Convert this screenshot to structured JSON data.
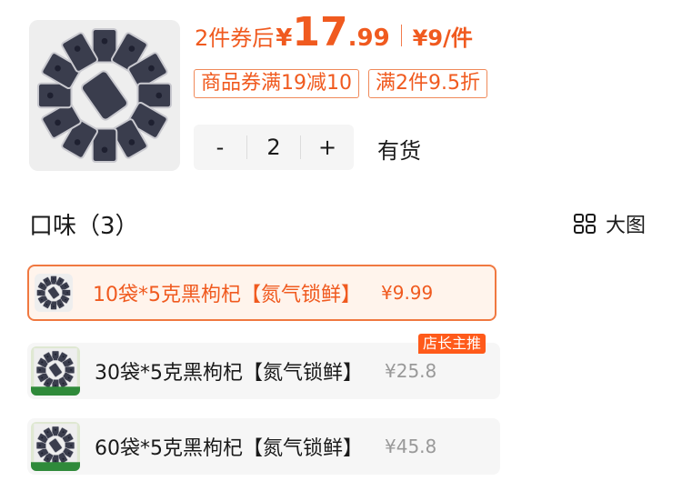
{
  "product": {
    "image_icon": "black-goji-packets-image",
    "price_prefix": "2件券后",
    "currency": "¥",
    "price_int": "17",
    "price_dec": ".99",
    "unit_price": "¥9/件",
    "coupons": [
      "商品券满19减10",
      "满2件9.5折"
    ],
    "quantity": "2",
    "minus_label": "-",
    "plus_label": "+",
    "stock": "有货"
  },
  "flavor": {
    "title": "口味（3）",
    "bigview_label": "大图",
    "bigview_icon": "grid-icon",
    "options": [
      {
        "name": "10袋*5克黑枸杞【氮气锁鲜】",
        "price": "¥9.99",
        "selected": true
      },
      {
        "name": "30袋*5克黑枸杞【氮气锁鲜】",
        "price": "¥25.8",
        "badge": "店长主推"
      },
      {
        "name": "60袋*5克黑枸杞【氮气锁鲜】",
        "price": "¥45.8"
      }
    ]
  },
  "colors": {
    "accent": "#f05a1f",
    "selected_bg": "#fff4ec",
    "muted_price": "#999999",
    "badge": "#ff5a1a"
  }
}
